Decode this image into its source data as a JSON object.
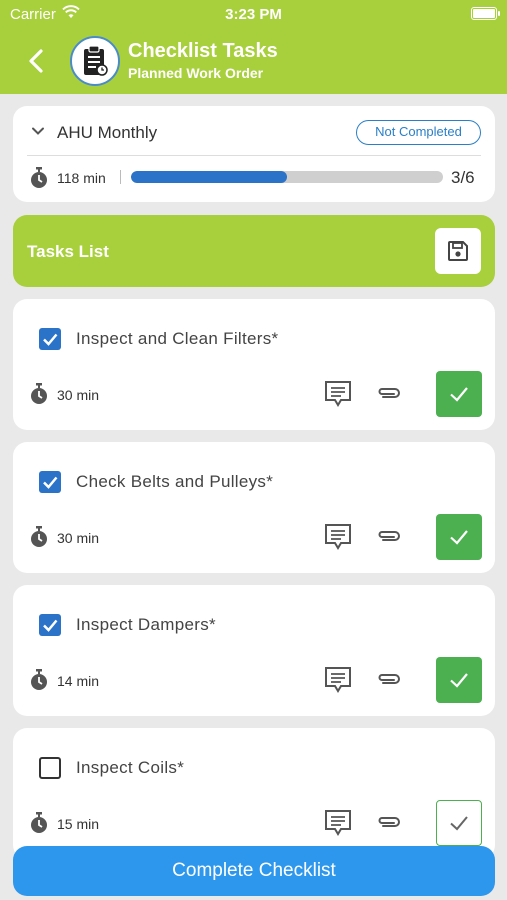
{
  "status_bar": {
    "carrier": "Carrier",
    "time": "3:23 PM"
  },
  "header": {
    "title": "Checklist Tasks",
    "subtitle": "Planned Work Order"
  },
  "summary": {
    "name": "AHU Monthly",
    "status": "Not Completed",
    "total_time": "118 min",
    "progress_count": "3/6",
    "progress_fraction": 0.5
  },
  "tasks_header": {
    "label": "Tasks List"
  },
  "tasks": [
    {
      "name": "Inspect and Clean Filters*",
      "time": "30 min",
      "checked": true,
      "completed": true
    },
    {
      "name": "Check Belts and Pulleys*",
      "time": "30 min",
      "checked": true,
      "completed": true
    },
    {
      "name": "Inspect Dampers*",
      "time": "14 min",
      "checked": true,
      "completed": true
    },
    {
      "name": "Inspect Coils*",
      "time": "15 min",
      "checked": false,
      "completed": false
    }
  ],
  "footer": {
    "complete_label": "Complete Checklist"
  },
  "colors": {
    "brand_green": "#a8cf3c",
    "primary_blue": "#2d97ee",
    "progress_blue": "#2a73c9",
    "done_green": "#4caf50"
  }
}
